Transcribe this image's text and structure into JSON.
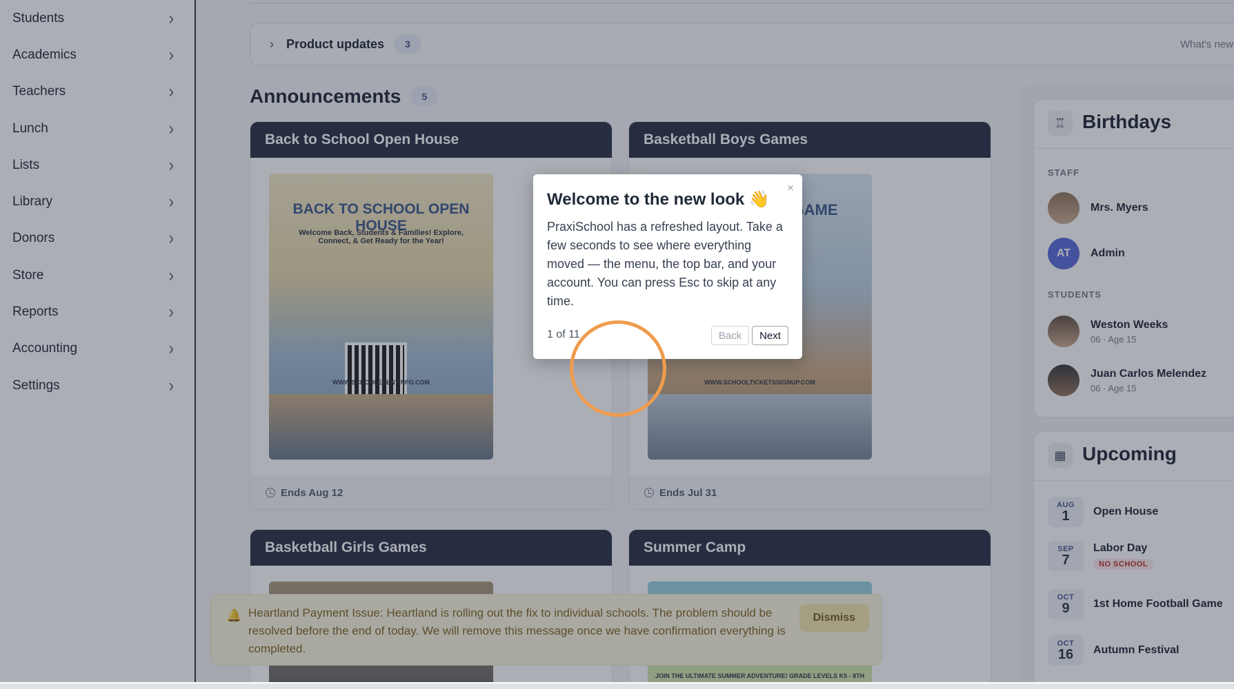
{
  "sidebar": {
    "items": [
      {
        "label": "Students"
      },
      {
        "label": "Academics"
      },
      {
        "label": "Teachers"
      },
      {
        "label": "Lunch"
      },
      {
        "label": "Lists"
      },
      {
        "label": "Library"
      },
      {
        "label": "Donors"
      },
      {
        "label": "Store"
      },
      {
        "label": "Reports"
      },
      {
        "label": "Accounting"
      },
      {
        "label": "Settings"
      }
    ]
  },
  "updates": {
    "title": "Product updates",
    "count": "3",
    "link": "What's new"
  },
  "announcements": {
    "title": "Announcements",
    "count": "5",
    "cards": [
      {
        "title": "Back to School Open House",
        "ends": "Ends Aug 12",
        "poster_heading": "BACK TO SCHOOL OPEN HOUSE",
        "poster_sub": "Welcome Back, Students & Families! Explore, Connect, & Get Ready for the Year!",
        "poster_url": "WWW.SCHOOLEVENTINFO.COM"
      },
      {
        "title": "Basketball Boys Games",
        "ends": "Ends Jul 31",
        "poster_heading": "GAME",
        "poster_url": "WWW.SCHOOLTICKETSSIGNUP.COM"
      },
      {
        "title": "Basketball Girls Games"
      },
      {
        "title": "Summer Camp",
        "poster_banner": "JOIN THE ULTIMATE SUMMER ADVENTURE! GRADE LEVELS K5 - 8TH"
      }
    ]
  },
  "birthdays": {
    "title": "Birthdays",
    "staff_label": "STAFF",
    "staff": [
      {
        "name": "Mrs. Myers"
      },
      {
        "name": "Admin",
        "initials": "AT"
      }
    ],
    "students_label": "STUDENTS",
    "students": [
      {
        "name": "Weston Weeks",
        "detail": "06 · Age 15"
      },
      {
        "name": "Juan Carlos Melendez",
        "detail": "06 · Age 15"
      }
    ]
  },
  "upcoming": {
    "title": "Upcoming",
    "events": [
      {
        "month": "AUG",
        "day": "1",
        "name": "Open House"
      },
      {
        "month": "SEP",
        "day": "7",
        "name": "Labor Day",
        "tag": "NO SCHOOL"
      },
      {
        "month": "OCT",
        "day": "9",
        "name": "1st Home Football Game"
      },
      {
        "month": "OCT",
        "day": "16",
        "name": "Autumn Festival"
      }
    ]
  },
  "banner": {
    "message": "Heartland Payment Issue: Heartland is rolling out the fix to individual schools. The problem should be resolved before the end of today. We will remove this message once we have confirmation everything is completed.",
    "dismiss": "Dismiss"
  },
  "tour": {
    "title": "Welcome to the new look 👋",
    "body": "PraxiSchool has a refreshed layout. Take a few seconds to see where everything moved — the menu, the top bar, and your account. You can press Esc to skip at any time.",
    "progress": "1 of 11",
    "back": "Back",
    "next": "Next",
    "close": "×"
  },
  "colors": {
    "header": "#1a2238",
    "accent": "#3b4a86",
    "highlight_ring": "#ef9c4e",
    "banner_bg": "#fbf6df"
  }
}
